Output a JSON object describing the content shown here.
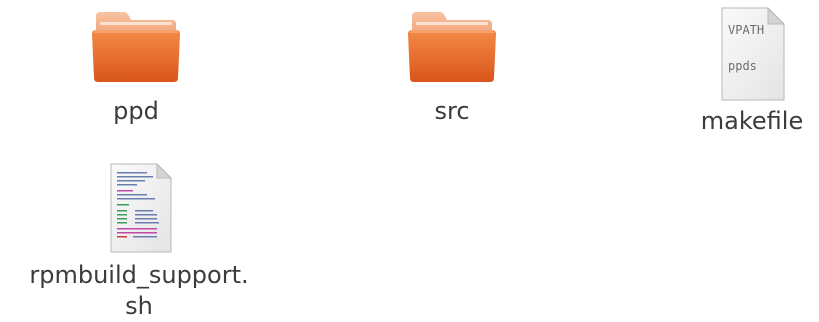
{
  "files": [
    {
      "name": "ppd",
      "type": "folder",
      "icon": "folder-icon"
    },
    {
      "name": "src",
      "type": "folder",
      "icon": "folder-icon"
    },
    {
      "name": "makefile",
      "type": "text",
      "icon": "text-document-icon",
      "preview_lines": [
        "VPATH",
        "ppds"
      ]
    },
    {
      "name": "rpmbuild_support.\nsh",
      "type": "script",
      "icon": "shell-script-icon"
    }
  ],
  "colors": {
    "folder_orange": "#e96f2a",
    "folder_light": "#f6b58c",
    "label_text": "#3c3c3c",
    "background": "#ffffff"
  }
}
